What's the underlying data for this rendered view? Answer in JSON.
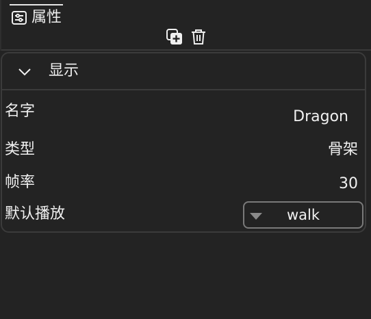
{
  "header": {
    "tab_label": "属性",
    "tab_icon": "sliders-icon",
    "toolbar": {
      "add_icon": "add-copy-icon",
      "delete_icon": "trash-icon"
    }
  },
  "panel": {
    "title": "显示",
    "expanded": true,
    "rows": [
      {
        "label": "名字",
        "value": "Dragon"
      },
      {
        "label": "类型",
        "value": "骨架"
      },
      {
        "label": "帧率",
        "value": "30"
      },
      {
        "label": "默认播放",
        "value": "walk"
      }
    ]
  },
  "colors": {
    "background": "#232323",
    "border": "#3b3b3b",
    "text": "#f0f0f0",
    "dropdown_border": "#7a7a7a"
  }
}
